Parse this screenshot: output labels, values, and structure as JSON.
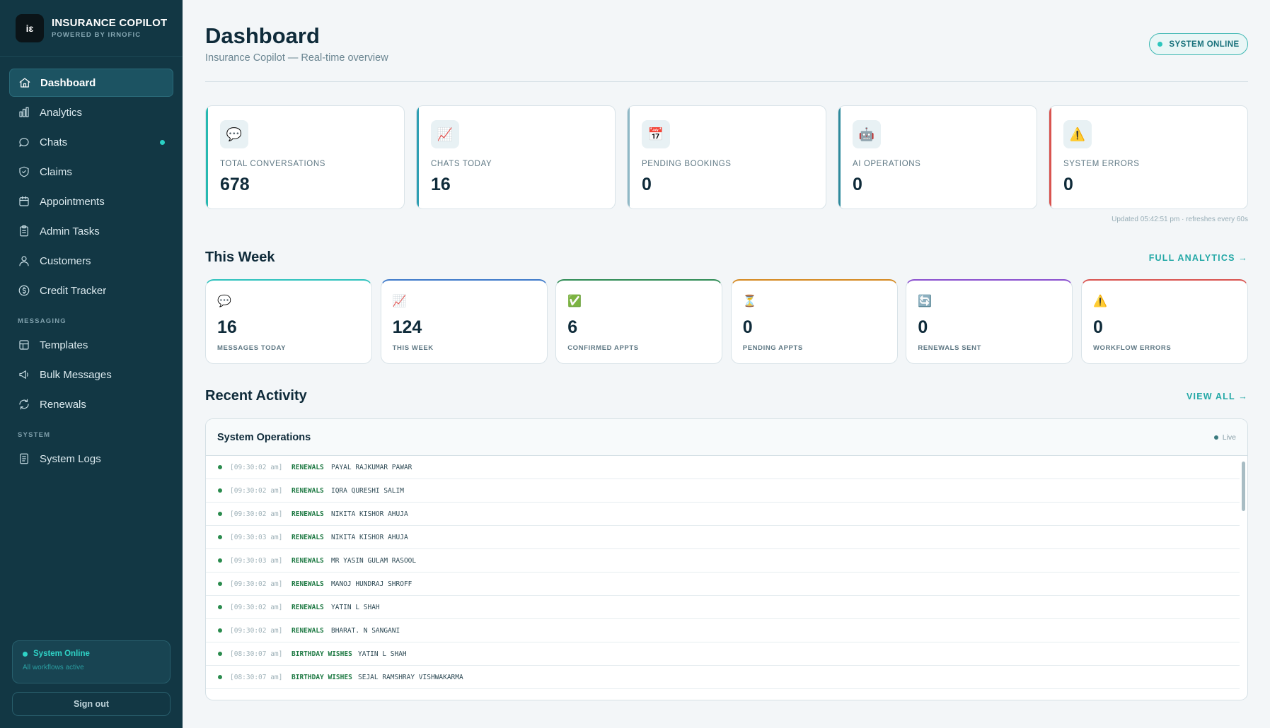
{
  "brand": {
    "logo": "iɛ",
    "title": "INSURANCE COPILOT",
    "subtitle": "POWERED BY IRNOFIC"
  },
  "nav": {
    "main": [
      {
        "label": "Dashboard",
        "icon": "home-icon",
        "active": true
      },
      {
        "label": "Analytics",
        "icon": "bar-chart-icon"
      },
      {
        "label": "Chats",
        "icon": "chat-bubble-icon",
        "badge": true
      },
      {
        "label": "Claims",
        "icon": "shield-icon"
      },
      {
        "label": "Appointments",
        "icon": "calendar-icon"
      },
      {
        "label": "Admin Tasks",
        "icon": "clipboard-icon"
      },
      {
        "label": "Customers",
        "icon": "users-icon"
      },
      {
        "label": "Credit Tracker",
        "icon": "dollar-icon"
      }
    ],
    "messaging_label": "MESSAGING",
    "messaging": [
      {
        "label": "Templates",
        "icon": "template-icon"
      },
      {
        "label": "Bulk Messages",
        "icon": "megaphone-icon"
      },
      {
        "label": "Renewals",
        "icon": "refresh-icon"
      }
    ],
    "system_label": "SYSTEM",
    "system": [
      {
        "label": "System Logs",
        "icon": "log-icon"
      }
    ]
  },
  "sidebar_status": {
    "title": "System Online",
    "subtitle": "All workflows active"
  },
  "signout_label": "Sign out",
  "header": {
    "title": "Dashboard",
    "subtitle": "Insurance Copilot — Real-time overview",
    "status": "SYSTEM ONLINE"
  },
  "kpis": [
    {
      "label": "TOTAL CONVERSATIONS",
      "value": "678",
      "icon": "💬"
    },
    {
      "label": "CHATS TODAY",
      "value": "16",
      "icon": "📈"
    },
    {
      "label": "PENDING BOOKINGS",
      "value": "0",
      "icon": "📅"
    },
    {
      "label": "AI OPERATIONS",
      "value": "0",
      "icon": "🤖"
    },
    {
      "label": "SYSTEM ERRORS",
      "value": "0",
      "icon": "⚠️"
    }
  ],
  "updated_text": "Updated 05:42:51 pm · refreshes every 60s",
  "this_week": {
    "title": "This Week",
    "link": "FULL ANALYTICS →",
    "cards": [
      {
        "label": "MESSAGES TODAY",
        "value": "16",
        "icon": "💬"
      },
      {
        "label": "THIS WEEK",
        "value": "124",
        "icon": "📈"
      },
      {
        "label": "CONFIRMED APPTS",
        "value": "6",
        "icon": "✅"
      },
      {
        "label": "PENDING APPTS",
        "value": "0",
        "icon": "⏳"
      },
      {
        "label": "RENEWALS SENT",
        "value": "0",
        "icon": "🔄"
      },
      {
        "label": "WORKFLOW ERRORS",
        "value": "0",
        "icon": "⚠️"
      }
    ]
  },
  "recent": {
    "title": "Recent Activity",
    "link": "VIEW ALL →",
    "panel_title": "System Operations",
    "live_label": "Live",
    "logs": [
      {
        "time": "[09:30:02 am]",
        "category": "RENEWALS",
        "name": "PAYAL RAJKUMAR PAWAR"
      },
      {
        "time": "[09:30:02 am]",
        "category": "RENEWALS",
        "name": "IQRA QURESHI SALIM"
      },
      {
        "time": "[09:30:02 am]",
        "category": "RENEWALS",
        "name": "NIKITA KISHOR AHUJA"
      },
      {
        "time": "[09:30:03 am]",
        "category": "RENEWALS",
        "name": "NIKITA KISHOR AHUJA"
      },
      {
        "time": "[09:30:03 am]",
        "category": "RENEWALS",
        "name": "MR YASIN GULAM RASOOL"
      },
      {
        "time": "[09:30:02 am]",
        "category": "RENEWALS",
        "name": "MANOJ HUNDRAJ SHROFF"
      },
      {
        "time": "[09:30:02 am]",
        "category": "RENEWALS",
        "name": "YATIN L SHAH"
      },
      {
        "time": "[09:30:02 am]",
        "category": "RENEWALS",
        "name": "BHARAT. N SANGANI"
      },
      {
        "time": "[08:30:07 am]",
        "category": "BIRTHDAY WISHES",
        "name": "YATIN L SHAH"
      },
      {
        "time": "[08:30:07 am]",
        "category": "BIRTHDAY WISHES",
        "name": "SEJAL RAMSHRAY VISHWAKARMA"
      }
    ]
  },
  "colors": {
    "sidebar": "#123744",
    "accent": "#23a8a6",
    "background": "#f3f6f8",
    "error": "#d9534f"
  }
}
